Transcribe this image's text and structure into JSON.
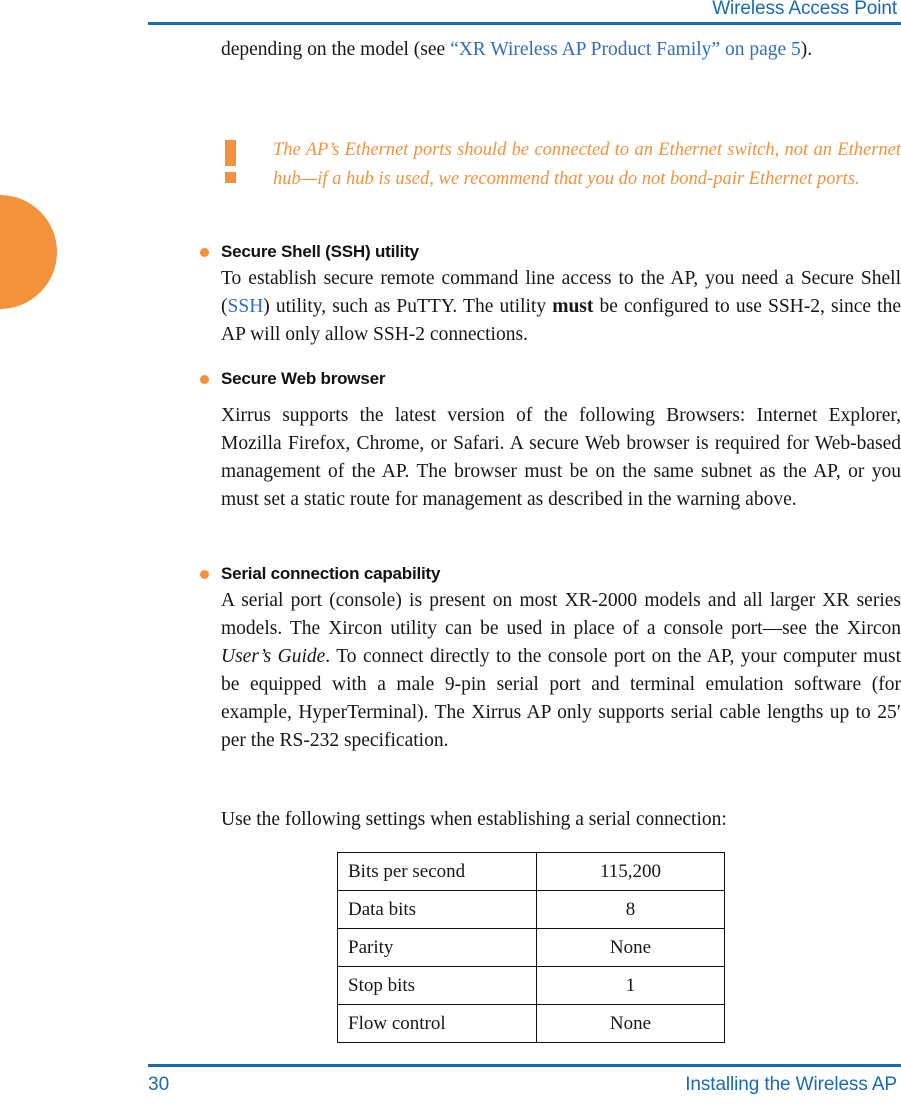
{
  "header": {
    "title": "Wireless Access Point"
  },
  "intro": {
    "text_before_link": "depending on the model (see ",
    "link_text": "“XR Wireless AP Product Family” on page 5",
    "text_after_link": ")."
  },
  "note": {
    "icon": "exclamation-icon",
    "text": "The AP’s Ethernet ports should be connected to an Ethernet switch, not an Ethernet hub—if a hub is used, we recommend that you do not bond-pair Ethernet ports."
  },
  "bullets": [
    {
      "heading": "Secure Shell (SSH) utility",
      "para_part1": "To establish secure remote command line access to the AP, you need a Secure Shell (",
      "para_link": "SSH",
      "para_part2": ") utility, such as PuTTY. The utility ",
      "para_bold": "must",
      "para_part3": " be configured to use SSH-2, since the AP will only allow SSH-2 connections."
    },
    {
      "heading": "Secure Web browser",
      "para": "Xirrus supports the latest version of the following Browsers: Internet Explorer, Mozilla Firefox, Chrome, or Safari. A secure Web browser is required for Web-based management of the AP. The browser must be on the same subnet as the AP, or you must set a static route for management as described in the warning above."
    },
    {
      "heading": "Serial connection capability",
      "para_part1": "A serial port (console) is present on most XR-2000 models and all larger XR series models. The  Xircon utility can be used in place of a console port—see the Xircon ",
      "para_italic": "User’s Guide",
      "para_part2": ". To connect directly to the console port on the AP, your computer must be equipped with a male 9-pin serial port and terminal emulation software (for example, HyperTerminal). The Xirrus AP only supports serial cable lengths up to 25′ per the RS-232 specification."
    }
  ],
  "pre_table_text": "Use the following settings when establishing a serial connection:",
  "settings_table": {
    "rows": [
      {
        "label": "Bits per second",
        "value": "115,200"
      },
      {
        "label": "Data bits",
        "value": "8"
      },
      {
        "label": "Parity",
        "value": "None"
      },
      {
        "label": "Stop bits",
        "value": "1"
      },
      {
        "label": "Flow control",
        "value": "None"
      }
    ]
  },
  "footer": {
    "page_number": "30",
    "section": "Installing the Wireless AP"
  },
  "colors": {
    "accent_blue": "#1a6ab0",
    "accent_orange": "#f4923c",
    "link_blue": "#2f6fb5",
    "text": "#161616"
  }
}
